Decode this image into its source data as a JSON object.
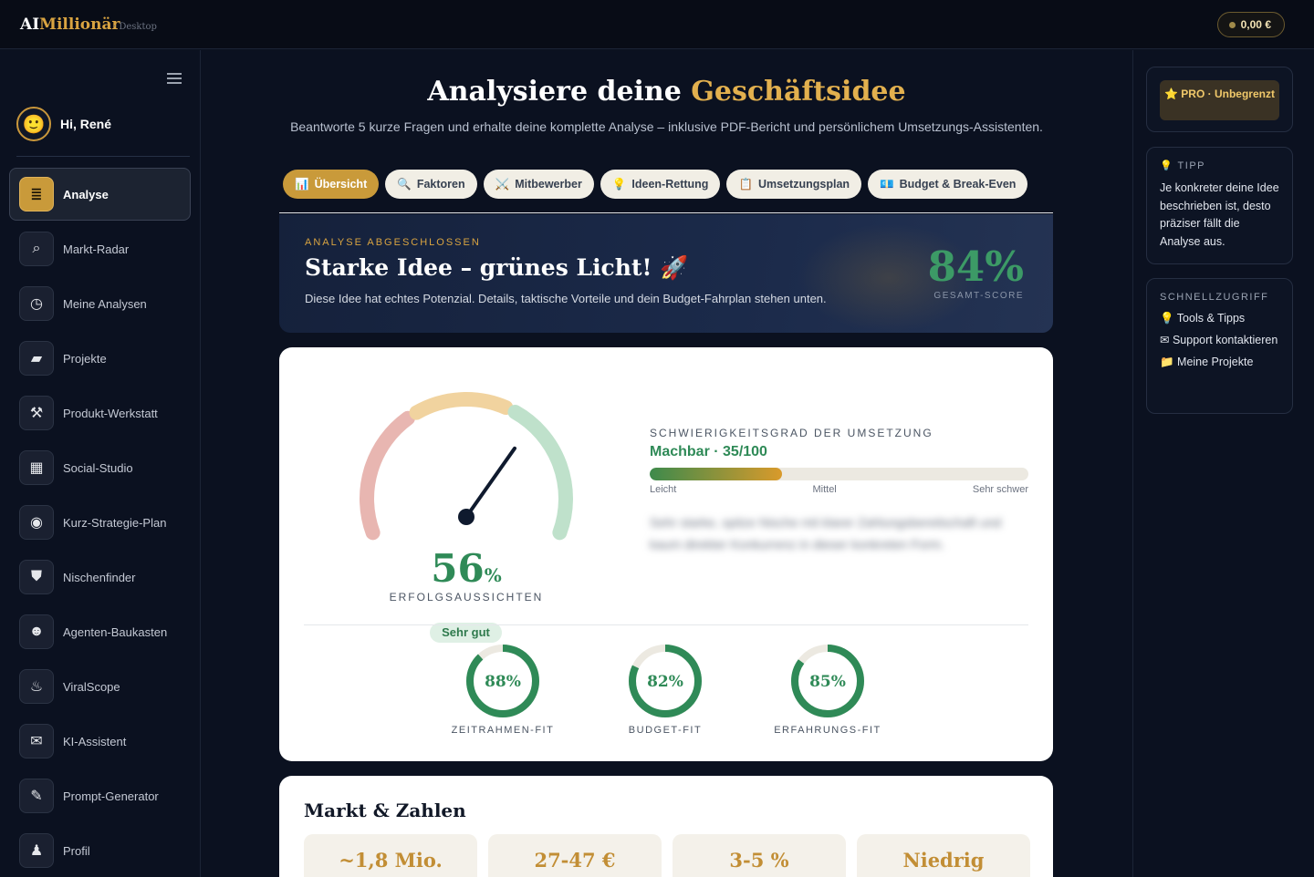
{
  "topbar": {
    "brand_ai": "AI",
    "brand_rest": "Millionär",
    "brand_sub": "· Desktop",
    "wallet": "0,00 €"
  },
  "sidebar": {
    "user_emoji": "🙂",
    "user_greeting": "Hi, René",
    "items": [
      {
        "label": "Analyse",
        "icon": "≣",
        "icon_name": "analysis-icon"
      },
      {
        "label": "Markt-Radar",
        "icon": "⌕",
        "icon_name": "radar-icon"
      },
      {
        "label": "Meine Analysen",
        "icon": "◷",
        "icon_name": "clock-icon"
      },
      {
        "label": "Projekte",
        "icon": "▰",
        "icon_name": "folder-icon"
      },
      {
        "label": "Produkt-Werkstatt",
        "icon": "⚒",
        "icon_name": "tools-icon"
      },
      {
        "label": "Social-Studio",
        "icon": "▦",
        "icon_name": "film-icon"
      },
      {
        "label": "Kurz-Strategie-Plan",
        "icon": "◉",
        "icon_name": "strategy-icon"
      },
      {
        "label": "Nischenfinder",
        "icon": "⛊",
        "icon_name": "niche-icon"
      },
      {
        "label": "Agenten-Baukasten",
        "icon": "☻",
        "icon_name": "robot-icon"
      },
      {
        "label": "ViralScope",
        "icon": "♨",
        "icon_name": "fire-icon"
      },
      {
        "label": "KI-Assistent",
        "icon": "✉",
        "icon_name": "chat-icon"
      },
      {
        "label": "Prompt-Generator",
        "icon": "✎",
        "icon_name": "magic-wand-icon"
      },
      {
        "label": "Profil",
        "icon": "♟",
        "icon_name": "user-icon"
      }
    ]
  },
  "main": {
    "title_part1": "Analysiere deine ",
    "title_part2": "Geschäftsidee",
    "subtitle": "Beantworte 5 kurze Fragen und erhalte deine komplette Analyse – inklusive PDF-Bericht und persönlichem Umsetzungs-Assistenten.",
    "tabs": [
      {
        "icon": "📊",
        "label": "Übersicht"
      },
      {
        "icon": "🔍",
        "label": "Faktoren"
      },
      {
        "icon": "⚔️",
        "label": "Mitbewerber"
      },
      {
        "icon": "💡",
        "label": "Ideen-Rettung"
      },
      {
        "icon": "📋",
        "label": "Umsetzungsplan"
      },
      {
        "icon": "💶",
        "label": "Budget & Break-Even"
      }
    ],
    "hero": {
      "kicker": "ANALYSE ABGESCHLOSSEN",
      "title": "Starke Idee – grünes Licht! 🚀",
      "text": "Diese Idee hat echtes Potenzial. Details, taktische Vorteile und dein Budget-Fahrplan stehen unten.",
      "score": "84%",
      "score_label": "GESAMT-SCORE"
    },
    "gauge": {
      "value": 56,
      "value_text": "56",
      "unit": "%",
      "label": "ERFOLGSAUSSICHTEN",
      "badge": "Sehr gut"
    },
    "difficulty": {
      "kicker": "SCHWIERIGKEITSGRAD DER UMSETZUNG",
      "value": "Machbar · 35/100",
      "score": 35,
      "scale_low": "Leicht",
      "scale_mid": "Mittel",
      "scale_high": "Sehr schwer",
      "blurred_text": "Sehr starke, spitze Nische mit klarer Zahlungsbereitschaft und kaum direkter Konkurrenz in dieser konkreten Form."
    },
    "rings": [
      {
        "value": 88,
        "text": "88%",
        "label": "ZEITRAHMEN-FIT"
      },
      {
        "value": 82,
        "text": "82%",
        "label": "BUDGET-FIT"
      },
      {
        "value": 85,
        "text": "85%",
        "label": "ERFAHRUNGS-FIT"
      }
    ],
    "market": {
      "title": "Markt & Zahlen",
      "stats": [
        "~1,8 Mio.",
        "27-47 €",
        "3-5 %",
        "Niedrig"
      ]
    }
  },
  "rail": {
    "pro_label": "⭐ PRO · Unbegrenzt",
    "tip_kicker": "💡 TIPP",
    "tip_text": "Je konkreter deine Idee beschrieben ist, desto präziser fällt die Analyse aus.",
    "quick_kicker": "SCHNELLZUGRIFF",
    "quick_links": [
      "💡 Tools & Tipps",
      "✉ Support kontaktieren",
      "📁 Meine Projekte"
    ]
  },
  "colors": {
    "accent_gold": "#c99a3a",
    "success_green": "#2f8a57",
    "background": "#0b1120"
  }
}
